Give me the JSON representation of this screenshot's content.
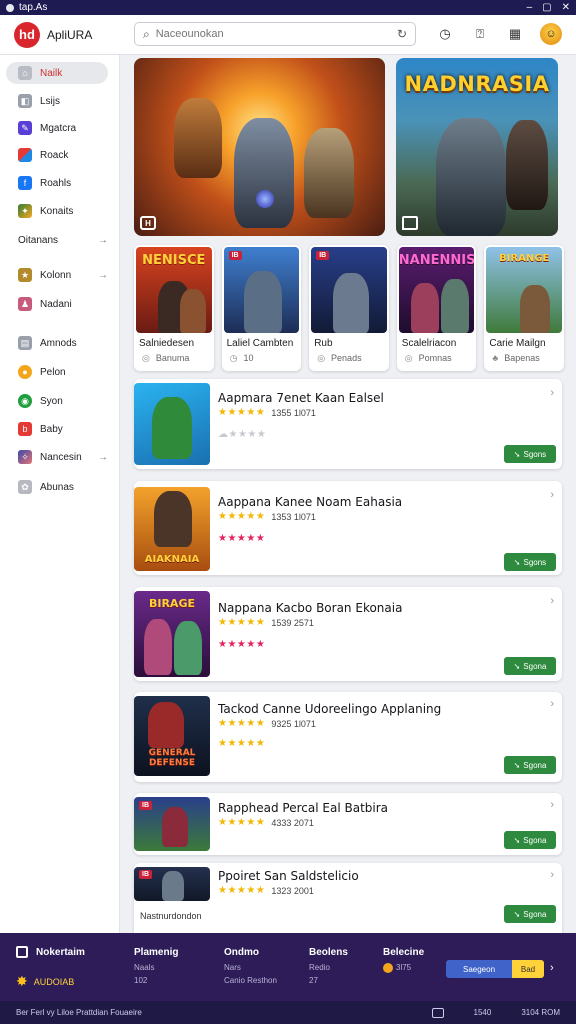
{
  "window": {
    "title": "tap.As",
    "controls": [
      "–",
      "▢",
      "✕"
    ]
  },
  "header": {
    "logo_text": "hd",
    "app_name": "ApliURA",
    "search_placeholder": "Naceounokan",
    "icons": [
      "compass-icon",
      "help-icon",
      "grid-icon",
      "avatar"
    ]
  },
  "sidebar": {
    "items": [
      {
        "label": "Nailk",
        "icon": "home-icon",
        "active": true
      },
      {
        "label": "Lsijs",
        "icon": "tag-icon"
      },
      {
        "label": "Mgatcra",
        "icon": "brush-icon"
      },
      {
        "label": "Roack",
        "icon": "flag-icon"
      },
      {
        "label": "Roahls",
        "icon": "facebook-icon"
      },
      {
        "label": "Konaits",
        "icon": "puzzle-icon"
      }
    ],
    "section_label": "Oitanans",
    "items2": [
      {
        "label": "Kolonn",
        "icon": "star-icon"
      },
      {
        "label": "Nadani",
        "icon": "person-icon"
      }
    ],
    "items3": [
      {
        "label": "Amnods",
        "icon": "clipboard-icon"
      },
      {
        "label": "Pelon",
        "icon": "coin-icon"
      },
      {
        "label": "Syon",
        "icon": "gamepad-icon"
      },
      {
        "label": "Baby",
        "icon": "baby-icon"
      },
      {
        "label": "Nancesin",
        "icon": "spark-icon"
      },
      {
        "label": "Abunas",
        "icon": "cluster-icon"
      }
    ]
  },
  "hero": [
    {
      "title": "",
      "badge": "H"
    },
    {
      "title": "NADNRASIA",
      "badge": ""
    }
  ],
  "featured_cards": [
    {
      "thumb_title": "NENISCE",
      "tag": "",
      "name": "Salniedesen",
      "meta": "Banuma"
    },
    {
      "thumb_title": "",
      "tag": "IB",
      "name": "Laliel Cambten",
      "meta": "10"
    },
    {
      "thumb_title": "",
      "tag": "IB",
      "name": "Rub",
      "meta": "Penads"
    },
    {
      "thumb_title": "NANENNIS",
      "tag": "",
      "name": "Scalelriacon",
      "meta": "Pomnas"
    },
    {
      "thumb_title": "BIRANGE",
      "tag": "",
      "name": "Carie Mailgn",
      "meta": "Bapenas"
    }
  ],
  "list": [
    {
      "name": "Aapmara 7enet Kaan Ealsel",
      "rating_text": "1355 1l071",
      "sub_stars": "☁★★★★",
      "button": "Sgons"
    },
    {
      "name": "Aappana Kanee Noam Eahasia",
      "rating_text": "1353 1l071",
      "sub_stars": "★★★★★",
      "button": "Sgons"
    },
    {
      "name": "Nappana Kacbo Boran Ekonaia",
      "rating_text": "1539 2571",
      "sub_stars": "★★★★★",
      "button": "Sgona"
    },
    {
      "name": "Tackod Canne Udoreelingo Applaning",
      "rating_text": "9325 1l071",
      "sub_stars": "★★★★★",
      "button": "Sgona"
    },
    {
      "name": "Rapphead Percal Eal Batbira",
      "rating_text": "4333 2071",
      "sub_stars": "",
      "button": "Sgona"
    },
    {
      "name": "Ppoiret San Saldstelicio",
      "rating_text": "1323 2001",
      "sub_stars": "",
      "button": "Sgona",
      "footer": "Nastnurdondon"
    }
  ],
  "bottom": {
    "brand": "Nokertaim",
    "tagline": "AUDOIAB",
    "cols": [
      {
        "title": "Plamenig",
        "l1": "Naals",
        "l2": "102"
      },
      {
        "title": "Ondmo",
        "l1": "Nars",
        "l2": "Canio Resthon"
      },
      {
        "title": "Beolens",
        "l1": "Redio",
        "l2": "27"
      },
      {
        "title": "Belecine",
        "l1": "3l75",
        "l2": ""
      }
    ],
    "cta_left": "Saegeon",
    "cta_right": "Bad",
    "next": "›"
  },
  "status": {
    "left": "Ber Ferl vy Liloe Prattdian   Fouaeire",
    "right1": "1540",
    "right2": "3104 ROM"
  }
}
